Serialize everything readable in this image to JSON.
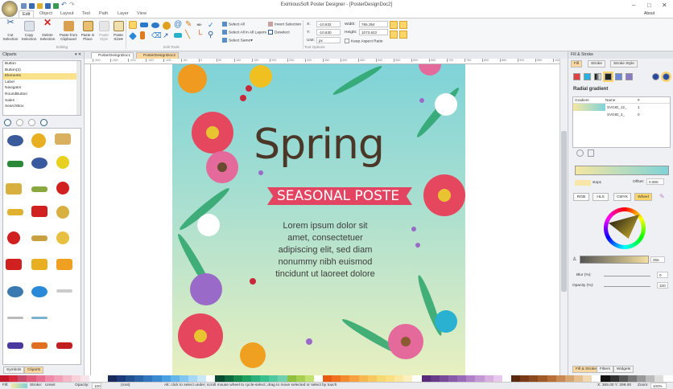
{
  "window": {
    "title": "EximiousSoft Poster Designer - [PosterDesignDoc2]",
    "about": "About"
  },
  "menu_tabs": [
    "Edit",
    "Object",
    "Layout",
    "Text",
    "Path",
    "Layer",
    "View"
  ],
  "ribbon": {
    "editing": {
      "label": "Editing",
      "buttons": [
        "Cut Selection",
        "Copy Selection",
        "Delete Selection",
        "Paste from Clipboard",
        "Paste in Place",
        "Paste Style",
        "Paste Size"
      ]
    },
    "edit_tools": {
      "label": "Edit Tools",
      "select_all": "Select All",
      "select_all_layers": "Select All in All Layers",
      "select_same": "Select Same",
      "invert_selection": "Invert Selection",
      "deselect": "Deselect"
    },
    "tool_options": {
      "label": "Tool Options",
      "x_label": "X:",
      "x": "-10.632",
      "y_label": "Y:",
      "y": "-10.630",
      "unit_label": "Unit:",
      "unit": "px",
      "width_label": "Width:",
      "width": "765.354",
      "height_label": "Height:",
      "height": "1073.622",
      "keep_aspect": "Keep Aspect Ratio"
    }
  },
  "cliparts": {
    "title": "Cliparts",
    "items": [
      "Button",
      "Button(2)",
      "Elements",
      "Label",
      "Navigator",
      "RoundButton",
      "Sales",
      "SearchBox"
    ],
    "selected": "Elements",
    "tabs": [
      "Symbols",
      "Cliparts"
    ]
  },
  "documents": {
    "tabs": [
      "PosterDesignDoc1",
      "PosterDesignDoc2"
    ],
    "active": "PosterDesignDoc2"
  },
  "ruler": {
    "ticks": [
      "-300",
      "-250",
      "-200",
      "-150",
      "-100",
      "-50",
      "0",
      "50",
      "100",
      "150",
      "200",
      "250",
      "300",
      "350",
      "400",
      "450",
      "500",
      "550",
      "600",
      "650",
      "700",
      "750",
      "800",
      "850",
      "900",
      "950",
      "1000"
    ]
  },
  "poster": {
    "title": "Spring",
    "banner": "SEASONAL POSTE",
    "body": [
      "Lorem ipsum dolor sit",
      "amet, consectetuer",
      "adipiscing elit, sed diam",
      "nonummy nibh euismod",
      "tincidunt ut laoreet dolore"
    ]
  },
  "fill_stroke": {
    "title": "Fill & Stroke",
    "tabs": [
      "Fill",
      "Stroke",
      "Stroke Style"
    ],
    "mode": "Radial gradient",
    "table": {
      "headers": [
        "Gradient",
        "Name",
        "#"
      ],
      "rows": [
        {
          "name": "SVGID_12_",
          "count": "1"
        },
        {
          "name": "SVGID_3_",
          "count": "0"
        }
      ]
    },
    "stop_label": "stop1",
    "offset_label": "Offset:",
    "offset": "0.000",
    "color_modes": [
      "RGB",
      "HLS",
      "CMYK",
      "Wheel"
    ],
    "active_mode": "Wheel",
    "alpha": "255",
    "blur_label": "Blur (%):",
    "blur": "0",
    "opacity_label": "Opacity (%):",
    "opacity": "100",
    "bottom_tabs": [
      "Fill & Stroke",
      "Filters",
      "Widgets"
    ]
  },
  "palette": [
    "#c0182a",
    "#d62a3c",
    "#c84a6a",
    "#e05a7a",
    "#e86e92",
    "#f08aa8",
    "#f2a0b8",
    "#f5b8c8",
    "#f8d0d8",
    "#f6e4ea",
    "#fff",
    "#fff",
    "#1a2a5a",
    "#1f3a7a",
    "#23508f",
    "#2a62a8",
    "#3276c0",
    "#3a8ad2",
    "#4aa0e0",
    "#62b4ea",
    "#80c6f0",
    "#a4d8f4",
    "#c8e8f8",
    "#fff",
    "#0a4a30",
    "#106a40",
    "#168a4a",
    "#1ea060",
    "#2ab07a",
    "#38c08c",
    "#50c8a0",
    "#70d0b0",
    "#90c040",
    "#a8d050",
    "#c0e070",
    "#fff",
    "#e85a10",
    "#f07020",
    "#f48a30",
    "#f8a040",
    "#f8b850",
    "#f8c860",
    "#f8d870",
    "#fae080",
    "#fbe8a0",
    "#fcf0c0",
    "#fff",
    "#5a2a7a",
    "#6a3a8a",
    "#7a4a9a",
    "#8a5aaa",
    "#9a6aba",
    "#b080c8",
    "#c498d4",
    "#d8b0e0",
    "#e8c8ec",
    "#fff",
    "#5a2a10",
    "#7a3a18",
    "#8a4a20",
    "#a05a28",
    "#b87038",
    "#c88a50",
    "#d8a470",
    "#e8c090",
    "#f0d8b0",
    "#fff",
    "#111",
    "#333",
    "#555",
    "#777",
    "#999",
    "#bbb",
    "#ddd",
    "#fff"
  ],
  "status": {
    "fill_label": "Fill:",
    "stroke_label": "Stroke:",
    "stroke": "Unset",
    "opacity_label": "Opacity:",
    "opacity": "100",
    "layer": "(root)",
    "hint": "Alt: click to select under; scroll mouse wheel to cycle-select; drag to move selected or select by touch",
    "coords": "X: 365.00 Y: 299.00",
    "zoom_label": "Zoom:",
    "zoom": "100%"
  }
}
